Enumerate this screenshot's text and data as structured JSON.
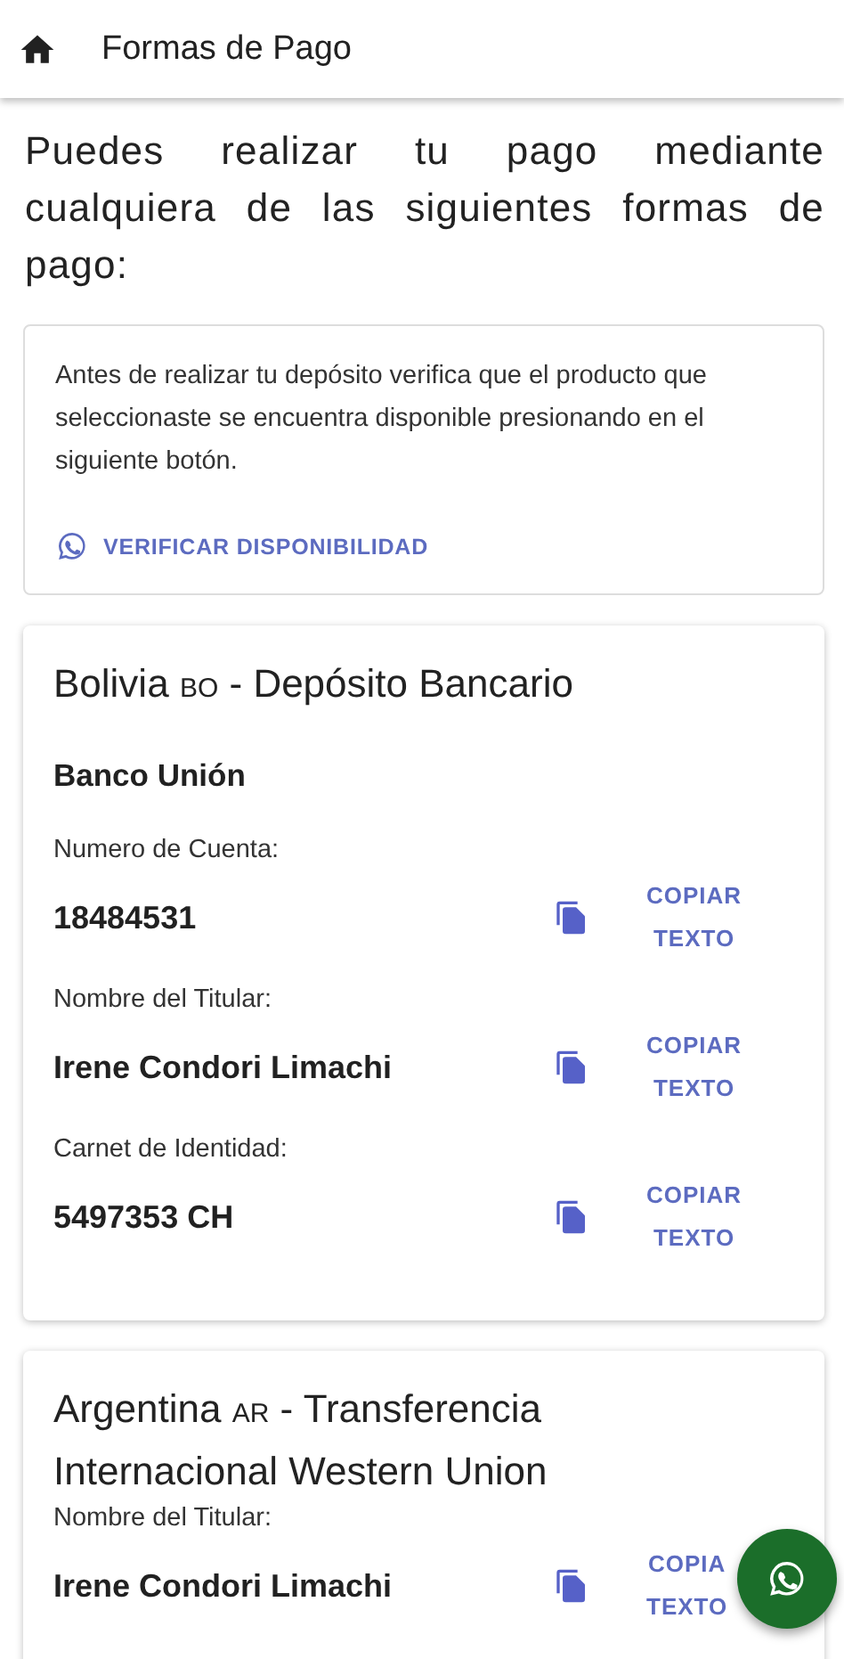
{
  "header": {
    "title": "Formas de Pago"
  },
  "intro": "Puedes realizar tu pago mediante cualquiera de las siguientes formas de pago:",
  "notice": {
    "text": "Antes de realizar tu depósito verifica que el producto que seleccionaste se encuentra disponible presionando en el siguiente botón.",
    "button": "VERIFICAR DISPONIBILIDAD"
  },
  "methods": [
    {
      "country": "Bolivia",
      "code": "BO",
      "method": "- Depósito Bancario",
      "bank": "Banco Unión",
      "fields": [
        {
          "label": "Numero de Cuenta:",
          "value": "18484531",
          "copy_button": "COPIAR TEXTO"
        },
        {
          "label": "Nombre del Titular:",
          "value": "Irene Condori Limachi",
          "copy_button": "COPIAR TEXTO"
        },
        {
          "label": "Carnet de Identidad:",
          "value": "5497353 CH",
          "copy_button": "COPIAR TEXTO"
        }
      ]
    },
    {
      "country": "Argentina",
      "code": "AR",
      "method": "- Transferencia Internacional Western Union",
      "fields": [
        {
          "label": "Nombre del Titular:",
          "value": "Irene Condori Limachi",
          "copy_button": "COPIA TEXTO"
        }
      ]
    }
  ]
}
